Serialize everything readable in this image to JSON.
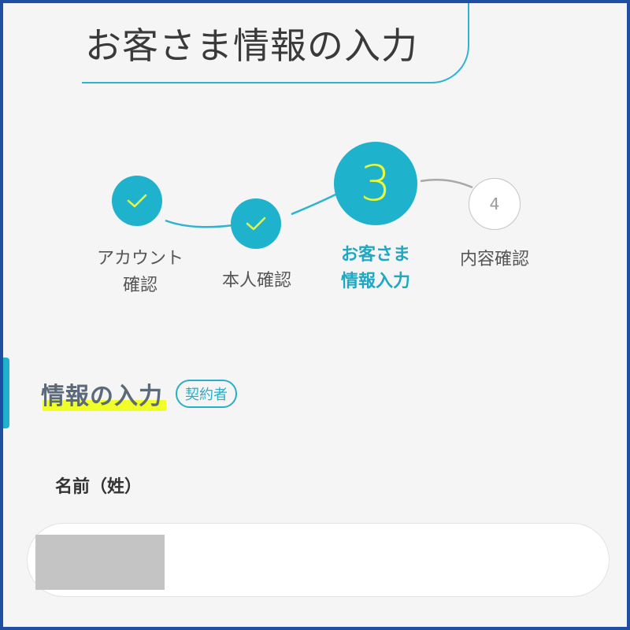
{
  "page": {
    "title": "お客さま情報の入力"
  },
  "stepper": {
    "steps": [
      {
        "label_lines": [
          "アカウント",
          "確認"
        ],
        "state": "done",
        "icon": "check-icon"
      },
      {
        "label_lines": [
          "本人確認"
        ],
        "state": "done",
        "icon": "check-icon"
      },
      {
        "number": "3",
        "label_lines": [
          "お客さま",
          "情報入力"
        ],
        "state": "current"
      },
      {
        "number": "4",
        "label_lines": [
          "内容確認"
        ],
        "state": "future"
      }
    ]
  },
  "section": {
    "heading": "情報の入力",
    "badge": "契約者"
  },
  "form": {
    "last_name_label": "名前（姓）",
    "last_name_value_redacted": true
  },
  "colors": {
    "accent": "#1fb2cc",
    "highlight": "#f0ff28",
    "frame": "#1f4fa3",
    "current_step_number": "#e8f83a"
  }
}
